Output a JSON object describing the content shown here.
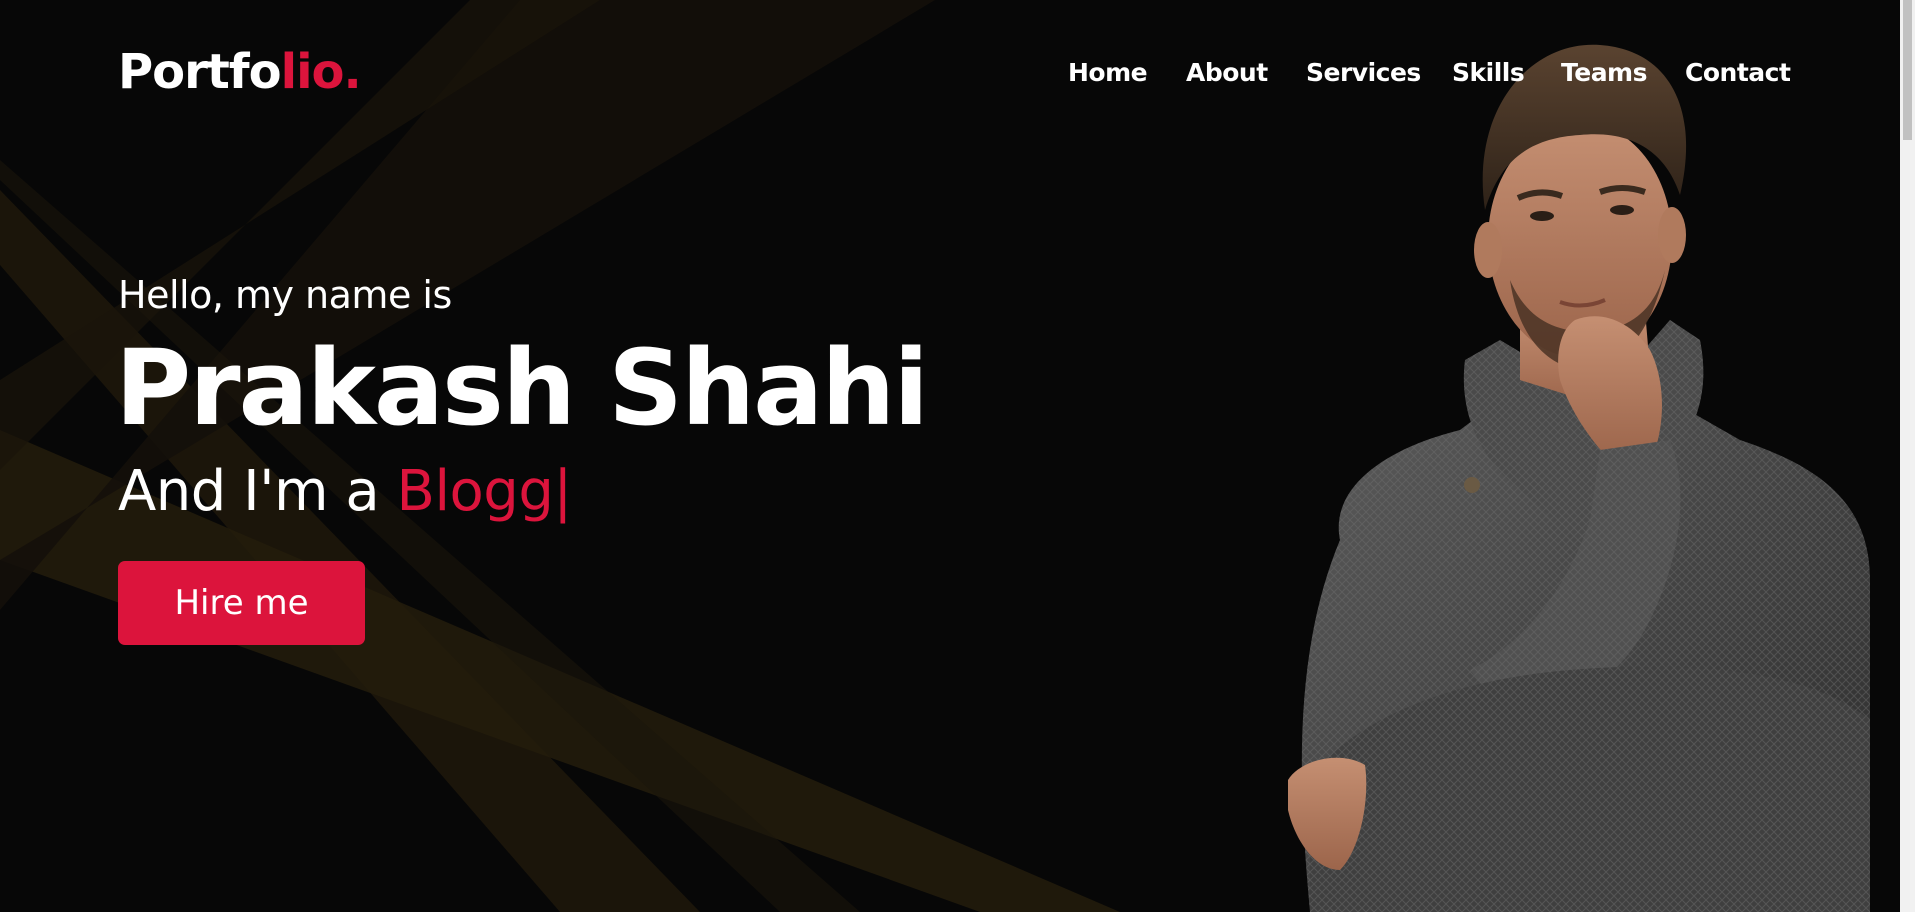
{
  "brand": {
    "logo_main": "Portfo",
    "logo_accent": "lio."
  },
  "nav": {
    "items": [
      {
        "label": "Home"
      },
      {
        "label": "About"
      },
      {
        "label": "Services"
      },
      {
        "label": "Skills"
      },
      {
        "label": "Teams"
      },
      {
        "label": "Contact"
      }
    ]
  },
  "hero": {
    "greeting": "Hello, my name is",
    "name": "Prakash Shahi",
    "role_prefix": "And I'm a ",
    "role_typed": "Blogg",
    "cursor": "|",
    "cta_label": "Hire me"
  },
  "colors": {
    "accent": "#dc143c",
    "background": "#070707",
    "text": "#ffffff",
    "ray": "#2a2210"
  }
}
